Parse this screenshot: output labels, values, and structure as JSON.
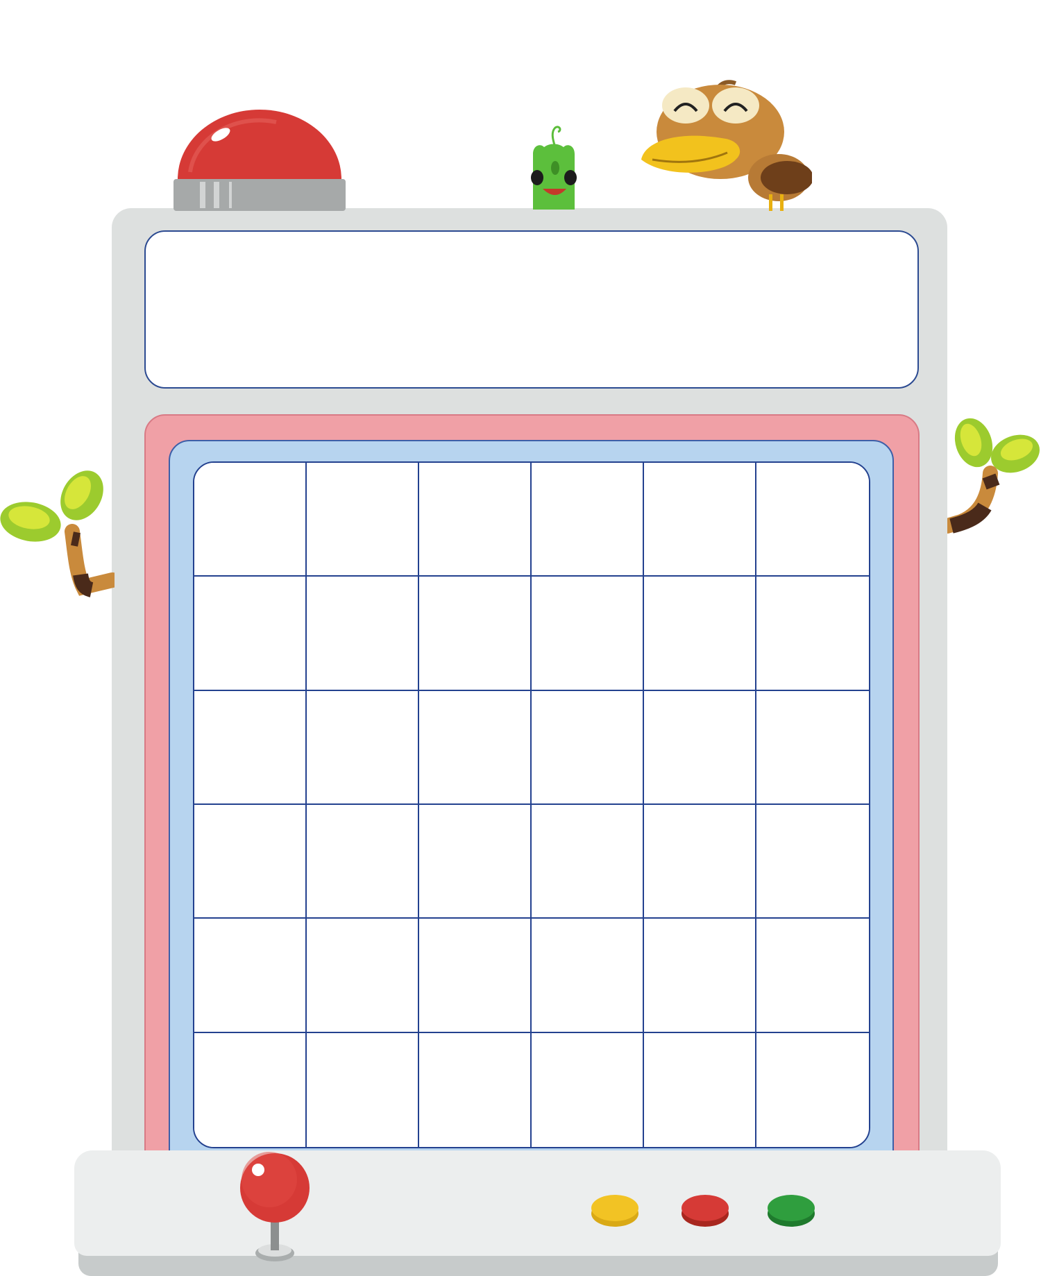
{
  "board": {
    "title": "",
    "rows": 6,
    "columns": 6,
    "cells": [
      [
        "",
        "",
        "",
        "",
        "",
        ""
      ],
      [
        "",
        "",
        "",
        "",
        "",
        ""
      ],
      [
        "",
        "",
        "",
        "",
        "",
        ""
      ],
      [
        "",
        "",
        "",
        "",
        "",
        ""
      ],
      [
        "",
        "",
        "",
        "",
        "",
        ""
      ],
      [
        "",
        "",
        "",
        "",
        "",
        ""
      ]
    ]
  },
  "colors": {
    "cabinet": "#dde0df",
    "outer_frame": "#f0a0a6",
    "inner_frame": "#b7d4ef",
    "grid_lines": "#23418f",
    "top_button": "#d63a36",
    "joystick_ball": "#d63a36",
    "button_yellow": "#f2c324",
    "button_red": "#d63a36",
    "button_green": "#2f9e3e"
  },
  "icons": [
    "dome-button-icon",
    "sprout-creature-icon",
    "bird-character-icon",
    "leaf-sprout-icon",
    "joystick-icon"
  ],
  "controls": {
    "buttons": [
      "yellow",
      "red",
      "green"
    ]
  }
}
